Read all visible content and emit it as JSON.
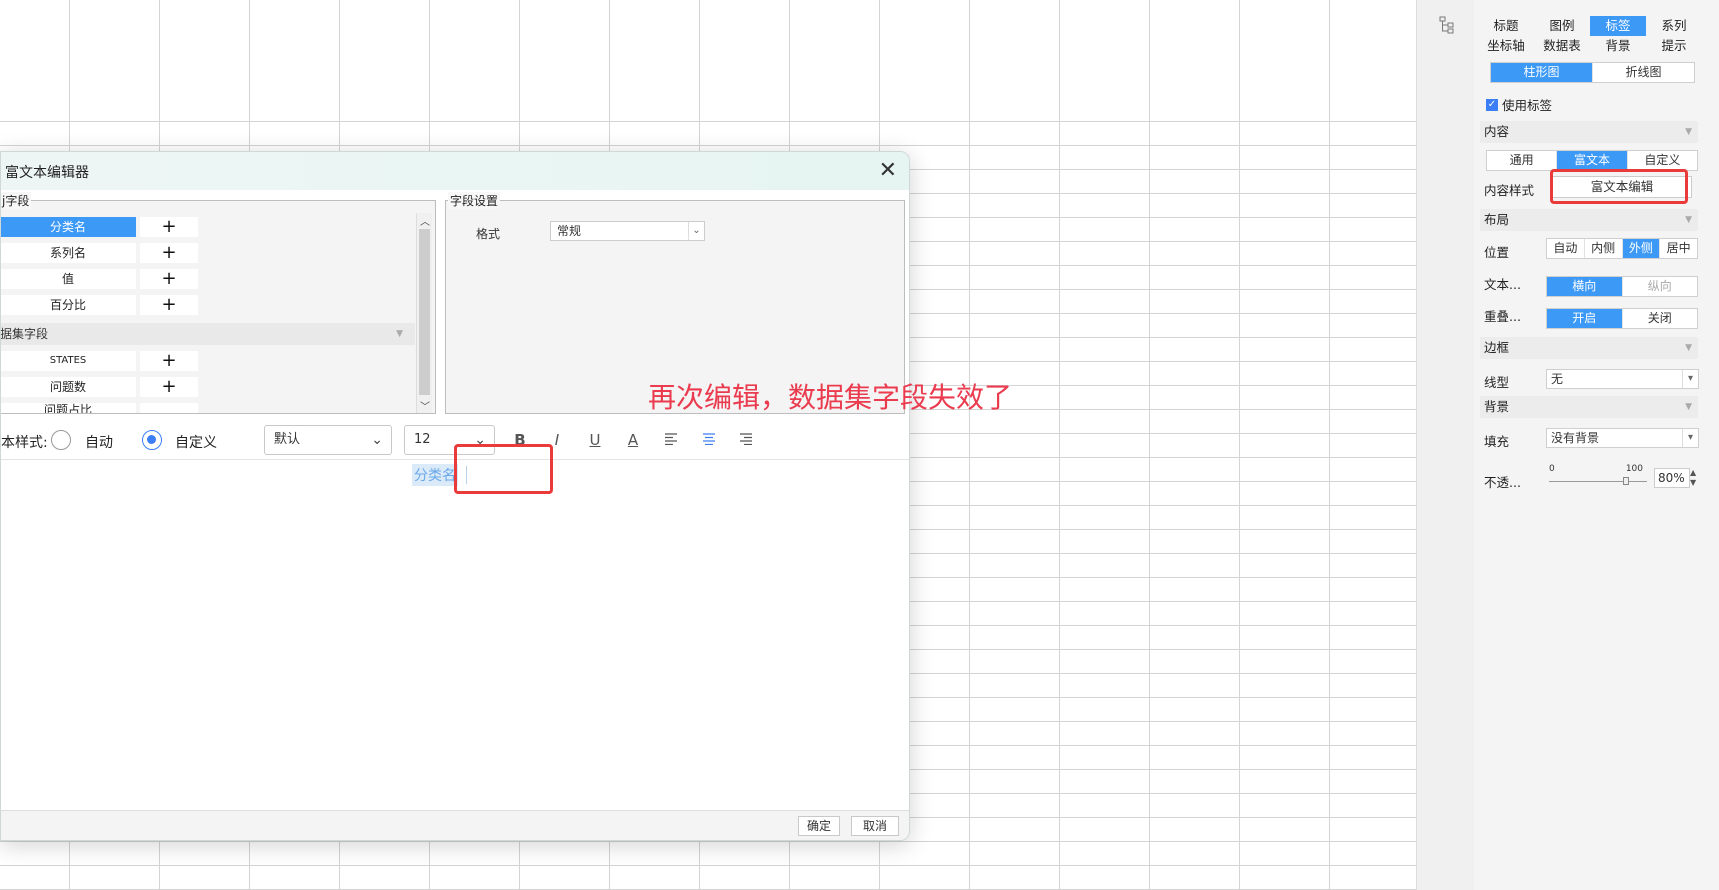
{
  "panel": {
    "tabs_row1": [
      "标题",
      "图例",
      "标签",
      "系列"
    ],
    "tabs_row2": [
      "坐标轴",
      "数据表",
      "背景",
      "提示"
    ],
    "active_tab": "标签",
    "chart_type_tabs": [
      "柱形图",
      "折线图"
    ],
    "use_label": "使用标签",
    "use_label_checked": true,
    "content_section": "内容",
    "content_modes": [
      "通用",
      "富文本",
      "自定义"
    ],
    "content_style_label": "内容样式",
    "rich_text_edit_button": "富文本编辑",
    "layout_section": "布局",
    "position_label": "位置",
    "position_options": [
      "自动",
      "内侧",
      "外侧",
      "居中"
    ],
    "text_label": "文本...",
    "text_options": [
      "横向",
      "纵向"
    ],
    "overlap_label": "重叠...",
    "overlap_options": [
      "开启",
      "关闭"
    ],
    "border_section": "边框",
    "line_type_label": "线型",
    "line_type_value": "无",
    "background_section": "背景",
    "fill_label": "填充",
    "fill_value": "没有背景",
    "opacity_label": "不透...",
    "opacity_min": "0",
    "opacity_max": "100",
    "opacity_value": "80%"
  },
  "dialog": {
    "title": "富文本编辑器",
    "fields_legend": "j字段",
    "chart_fields": [
      {
        "name": "分类名",
        "selected": true
      },
      {
        "name": "系列名",
        "selected": false
      },
      {
        "name": "值",
        "selected": false
      },
      {
        "name": "百分比",
        "selected": false
      }
    ],
    "dataset_group": "据集字段",
    "dataset_fields": [
      "STATES",
      "问题数",
      "问题占比"
    ],
    "field_settings_legend": "字段设置",
    "format_label": "格式",
    "format_value": "常规",
    "text_style_label": "本样式:",
    "auto_option": "自动",
    "custom_option": "自定义",
    "font_family": "默认",
    "font_size": "12",
    "editor_chip": "分类名",
    "ok_button": "确定",
    "cancel_button": "取消"
  },
  "annotation": "再次编辑，数据集字段失效了",
  "colors": {
    "accent": "#3c99f5",
    "annotation_red": "#ea3b4f"
  }
}
